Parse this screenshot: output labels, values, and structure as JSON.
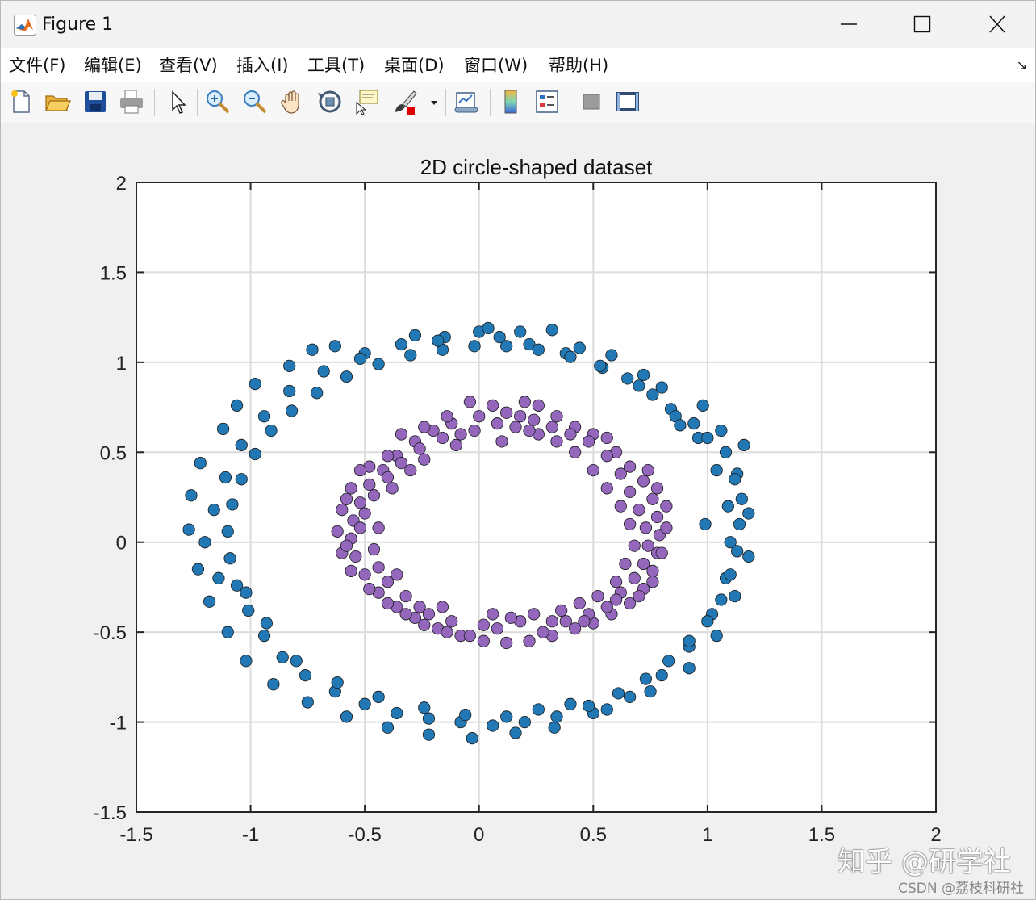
{
  "window": {
    "title": "Figure 1",
    "icon": "matlab-logo-icon",
    "controls": [
      "minimize-icon",
      "maximize-icon",
      "close-icon"
    ]
  },
  "menu": {
    "items": [
      "文件(F)",
      "编辑(E)",
      "查看(V)",
      "插入(I)",
      "工具(T)",
      "桌面(D)",
      "窗口(W)",
      "帮助(H)"
    ],
    "dock_arrow": "↘"
  },
  "toolbar": {
    "icons": [
      "new-figure-icon",
      "open-file-icon",
      "save-icon",
      "print-icon",
      "edit-plot-arrow-icon",
      "zoom-in-icon",
      "zoom-out-icon",
      "pan-hand-icon",
      "rotate-3d-icon",
      "data-cursor-icon",
      "brush-icon",
      "brush-dropdown-icon",
      "link-plot-icon",
      "insert-colorbar-icon",
      "insert-legend-icon",
      "hide-plot-tools-icon",
      "show-plot-tools-icon"
    ]
  },
  "watermark": {
    "main": "知乎 @研学社",
    "sub": "CSDN @荔枝科研社"
  },
  "colors": {
    "outer": "#2178b4",
    "inner": "#9467bd",
    "grid": "#dcdcdc",
    "axes": "#262626"
  },
  "chart_data": {
    "type": "scatter",
    "title": "2D circle-shaped dataset",
    "xlabel": "",
    "ylabel": "",
    "xlim": [
      -1.5,
      2
    ],
    "ylim": [
      -1.5,
      2
    ],
    "xticks": [
      "-1.5",
      "-1",
      "-0.5",
      "0",
      "0.5",
      "1",
      "1.5",
      "2"
    ],
    "yticks": [
      "-1.5",
      "-1",
      "-0.5",
      "0",
      "0.5",
      "1",
      "1.5",
      "2"
    ],
    "grid": true,
    "series": [
      {
        "color": "#2178b4",
        "points": [
          [
            0.0,
            1.17
          ],
          [
            0.04,
            1.19
          ],
          [
            0.09,
            1.14
          ],
          [
            0.18,
            1.17
          ],
          [
            0.32,
            1.18
          ],
          [
            -0.15,
            1.14
          ],
          [
            -0.28,
            1.15
          ],
          [
            -0.5,
            1.05
          ],
          [
            -0.63,
            1.09
          ],
          [
            -0.73,
            1.07
          ],
          [
            -0.83,
            0.98
          ],
          [
            -0.98,
            0.88
          ],
          [
            -1.06,
            0.76
          ],
          [
            -1.12,
            0.63
          ],
          [
            -1.22,
            0.44
          ],
          [
            -1.26,
            0.26
          ],
          [
            -1.27,
            0.07
          ],
          [
            -1.23,
            -0.15
          ],
          [
            -1.18,
            -0.33
          ],
          [
            -1.1,
            -0.5
          ],
          [
            -1.02,
            -0.66
          ],
          [
            -0.9,
            -0.79
          ],
          [
            -0.75,
            -0.89
          ],
          [
            -0.58,
            -0.97
          ],
          [
            -0.4,
            -1.03
          ],
          [
            -0.22,
            -1.07
          ],
          [
            -0.03,
            -1.09
          ],
          [
            0.16,
            -1.06
          ],
          [
            0.33,
            -1.03
          ],
          [
            0.5,
            -0.95
          ],
          [
            0.66,
            -0.86
          ],
          [
            0.8,
            -0.74
          ],
          [
            0.92,
            -0.58
          ],
          [
            1.02,
            -0.4
          ],
          [
            1.08,
            -0.2
          ],
          [
            1.1,
            0.0
          ],
          [
            1.09,
            0.2
          ],
          [
            1.04,
            0.4
          ],
          [
            0.96,
            0.58
          ],
          [
            0.84,
            0.74
          ],
          [
            0.7,
            0.87
          ],
          [
            0.54,
            0.97
          ],
          [
            0.38,
            1.05
          ],
          [
            0.22,
            1.1
          ],
          [
            0.86,
            0.7
          ],
          [
            0.94,
            0.66
          ],
          [
            1.0,
            0.58
          ],
          [
            1.08,
            0.5
          ],
          [
            1.13,
            0.38
          ],
          [
            1.15,
            0.24
          ],
          [
            1.14,
            0.1
          ],
          [
            1.13,
            -0.05
          ],
          [
            1.1,
            -0.18
          ],
          [
            1.06,
            -0.32
          ],
          [
            1.0,
            -0.44
          ],
          [
            0.92,
            -0.55
          ],
          [
            0.83,
            -0.66
          ],
          [
            0.73,
            -0.76
          ],
          [
            0.61,
            -0.84
          ],
          [
            0.48,
            -0.91
          ],
          [
            0.34,
            -0.97
          ],
          [
            0.2,
            -1.0
          ],
          [
            0.06,
            -1.02
          ],
          [
            -0.08,
            -1.0
          ],
          [
            -0.22,
            -0.98
          ],
          [
            -0.36,
            -0.95
          ],
          [
            -0.5,
            -0.9
          ],
          [
            -0.63,
            -0.83
          ],
          [
            -0.76,
            -0.74
          ],
          [
            -0.86,
            -0.64
          ],
          [
            -0.94,
            -0.52
          ],
          [
            -1.01,
            -0.38
          ],
          [
            -1.06,
            -0.24
          ],
          [
            -1.09,
            -0.09
          ],
          [
            -1.1,
            0.06
          ],
          [
            -1.08,
            0.21
          ],
          [
            -1.04,
            0.35
          ],
          [
            -0.98,
            0.49
          ],
          [
            -0.91,
            0.62
          ],
          [
            -0.82,
            0.73
          ],
          [
            -0.71,
            0.83
          ],
          [
            -0.58,
            0.92
          ],
          [
            -0.44,
            0.99
          ],
          [
            -0.3,
            1.04
          ],
          [
            -0.16,
            1.07
          ],
          [
            -0.02,
            1.09
          ],
          [
            0.12,
            1.09
          ],
          [
            0.26,
            1.07
          ],
          [
            0.4,
            1.03
          ],
          [
            0.53,
            0.98
          ],
          [
            0.65,
            0.91
          ],
          [
            0.76,
            0.82
          ],
          [
            0.88,
            0.65
          ],
          [
            1.12,
            0.35
          ],
          [
            1.18,
            0.16
          ],
          [
            1.18,
            -0.08
          ],
          [
            1.12,
            -0.3
          ],
          [
            1.04,
            -0.52
          ],
          [
            0.92,
            -0.7
          ],
          [
            0.75,
            -0.83
          ],
          [
            0.56,
            -0.93
          ],
          [
            0.4,
            -0.9
          ],
          [
            0.26,
            -0.93
          ],
          [
            0.12,
            -0.97
          ],
          [
            -0.06,
            -0.96
          ],
          [
            -0.24,
            -0.92
          ],
          [
            -0.44,
            -0.86
          ],
          [
            -0.62,
            -0.78
          ],
          [
            -0.8,
            -0.66
          ],
          [
            -0.93,
            -0.45
          ],
          [
            -1.02,
            -0.28
          ],
          [
            -1.14,
            -0.2
          ],
          [
            -1.2,
            0.0
          ],
          [
            -1.16,
            0.18
          ],
          [
            -1.11,
            0.36
          ],
          [
            -1.04,
            0.54
          ],
          [
            -0.94,
            0.7
          ],
          [
            -0.83,
            0.84
          ],
          [
            -0.68,
            0.95
          ],
          [
            -0.52,
            1.02
          ],
          [
            -0.34,
            1.1
          ],
          [
            -0.18,
            1.12
          ],
          [
            0.44,
            1.08
          ],
          [
            0.58,
            1.04
          ],
          [
            0.72,
            0.93
          ],
          [
            0.8,
            0.86
          ],
          [
            0.98,
            0.76
          ],
          [
            1.06,
            0.62
          ],
          [
            1.16,
            0.54
          ],
          [
            0.99,
            0.1
          ]
        ]
      },
      {
        "color": "#9467bd",
        "points": [
          [
            -0.04,
            0.78
          ],
          [
            0.06,
            0.76
          ],
          [
            0.12,
            0.72
          ],
          [
            0.2,
            0.78
          ],
          [
            0.26,
            0.76
          ],
          [
            0.34,
            0.7
          ],
          [
            0.42,
            0.64
          ],
          [
            0.5,
            0.6
          ],
          [
            0.56,
            0.58
          ],
          [
            0.6,
            0.5
          ],
          [
            0.66,
            0.42
          ],
          [
            0.72,
            0.34
          ],
          [
            0.76,
            0.24
          ],
          [
            0.78,
            0.14
          ],
          [
            0.79,
            0.04
          ],
          [
            0.78,
            -0.06
          ],
          [
            0.76,
            -0.16
          ],
          [
            0.72,
            -0.26
          ],
          [
            0.66,
            -0.34
          ],
          [
            0.58,
            -0.4
          ],
          [
            0.5,
            -0.45
          ],
          [
            0.42,
            -0.48
          ],
          [
            0.32,
            -0.52
          ],
          [
            0.22,
            -0.55
          ],
          [
            0.12,
            -0.56
          ],
          [
            0.02,
            -0.55
          ],
          [
            -0.08,
            -0.52
          ],
          [
            -0.18,
            -0.48
          ],
          [
            -0.28,
            -0.42
          ],
          [
            -0.36,
            -0.36
          ],
          [
            -0.44,
            -0.28
          ],
          [
            -0.5,
            -0.18
          ],
          [
            -0.54,
            -0.08
          ],
          [
            -0.56,
            0.02
          ],
          [
            -0.55,
            0.12
          ],
          [
            -0.52,
            0.22
          ],
          [
            -0.48,
            0.32
          ],
          [
            -0.42,
            0.4
          ],
          [
            -0.36,
            0.48
          ],
          [
            -0.28,
            0.56
          ],
          [
            -0.2,
            0.62
          ],
          [
            -0.12,
            0.66
          ],
          [
            -0.48,
            0.42
          ],
          [
            -0.56,
            0.3
          ],
          [
            -0.6,
            0.18
          ],
          [
            -0.62,
            0.06
          ],
          [
            -0.6,
            -0.06
          ],
          [
            -0.56,
            -0.16
          ],
          [
            -0.48,
            -0.26
          ],
          [
            -0.4,
            -0.34
          ],
          [
            -0.32,
            -0.4
          ],
          [
            -0.24,
            -0.46
          ],
          [
            -0.14,
            -0.5
          ],
          [
            -0.04,
            -0.52
          ],
          [
            0.08,
            -0.48
          ],
          [
            0.18,
            -0.44
          ],
          [
            0.28,
            -0.5
          ],
          [
            0.38,
            -0.44
          ],
          [
            0.48,
            -0.4
          ],
          [
            0.56,
            -0.36
          ],
          [
            0.62,
            -0.28
          ],
          [
            0.68,
            -0.2
          ],
          [
            0.72,
            -0.12
          ],
          [
            0.74,
            -0.02
          ],
          [
            0.73,
            0.08
          ],
          [
            0.7,
            0.18
          ],
          [
            0.66,
            0.28
          ],
          [
            0.62,
            0.38
          ],
          [
            0.56,
            0.48
          ],
          [
            0.48,
            0.56
          ],
          [
            0.4,
            0.6
          ],
          [
            0.32,
            0.64
          ],
          [
            0.24,
            0.68
          ],
          [
            0.16,
            0.64
          ],
          [
            0.08,
            0.66
          ],
          [
            0.0,
            0.7
          ],
          [
            -0.08,
            0.6
          ],
          [
            -0.16,
            0.58
          ],
          [
            -0.26,
            0.52
          ],
          [
            -0.34,
            0.44
          ],
          [
            -0.4,
            0.36
          ],
          [
            -0.46,
            0.26
          ],
          [
            -0.5,
            0.16
          ],
          [
            -0.44,
            0.08
          ],
          [
            -0.46,
            -0.04
          ],
          [
            -0.44,
            -0.14
          ],
          [
            -0.4,
            -0.22
          ],
          [
            -0.22,
            -0.4
          ],
          [
            -0.12,
            -0.44
          ],
          [
            0.02,
            -0.46
          ],
          [
            0.14,
            -0.42
          ],
          [
            0.24,
            -0.4
          ],
          [
            0.36,
            -0.38
          ],
          [
            0.44,
            -0.34
          ],
          [
            0.52,
            -0.3
          ],
          [
            0.6,
            -0.22
          ],
          [
            0.64,
            -0.12
          ],
          [
            0.68,
            -0.02
          ],
          [
            0.66,
            0.1
          ],
          [
            0.62,
            0.2
          ],
          [
            0.56,
            0.3
          ],
          [
            0.5,
            0.4
          ],
          [
            0.42,
            0.5
          ],
          [
            0.34,
            0.56
          ],
          [
            0.26,
            0.6
          ],
          [
            0.18,
            0.7
          ],
          [
            0.1,
            0.56
          ],
          [
            -0.02,
            0.62
          ],
          [
            -0.1,
            0.54
          ],
          [
            -0.24,
            0.46
          ],
          [
            -0.3,
            0.4
          ],
          [
            -0.38,
            0.3
          ],
          [
            -0.52,
            0.08
          ],
          [
            -0.58,
            -0.02
          ],
          [
            -0.36,
            -0.18
          ],
          [
            -0.32,
            -0.3
          ],
          [
            -0.26,
            -0.36
          ],
          [
            -0.16,
            -0.36
          ],
          [
            0.06,
            -0.4
          ],
          [
            0.32,
            -0.44
          ],
          [
            0.46,
            -0.44
          ],
          [
            0.6,
            -0.32
          ],
          [
            0.74,
            0.4
          ],
          [
            0.78,
            0.3
          ],
          [
            0.82,
            0.2
          ],
          [
            0.82,
            0.08
          ],
          [
            0.8,
            -0.06
          ],
          [
            0.76,
            -0.22
          ],
          [
            0.7,
            -0.3
          ],
          [
            -0.58,
            0.24
          ],
          [
            -0.52,
            0.4
          ],
          [
            -0.4,
            0.48
          ],
          [
            -0.34,
            0.6
          ],
          [
            -0.24,
            0.64
          ],
          [
            -0.14,
            0.7
          ],
          [
            0.22,
            0.62
          ]
        ]
      }
    ]
  }
}
